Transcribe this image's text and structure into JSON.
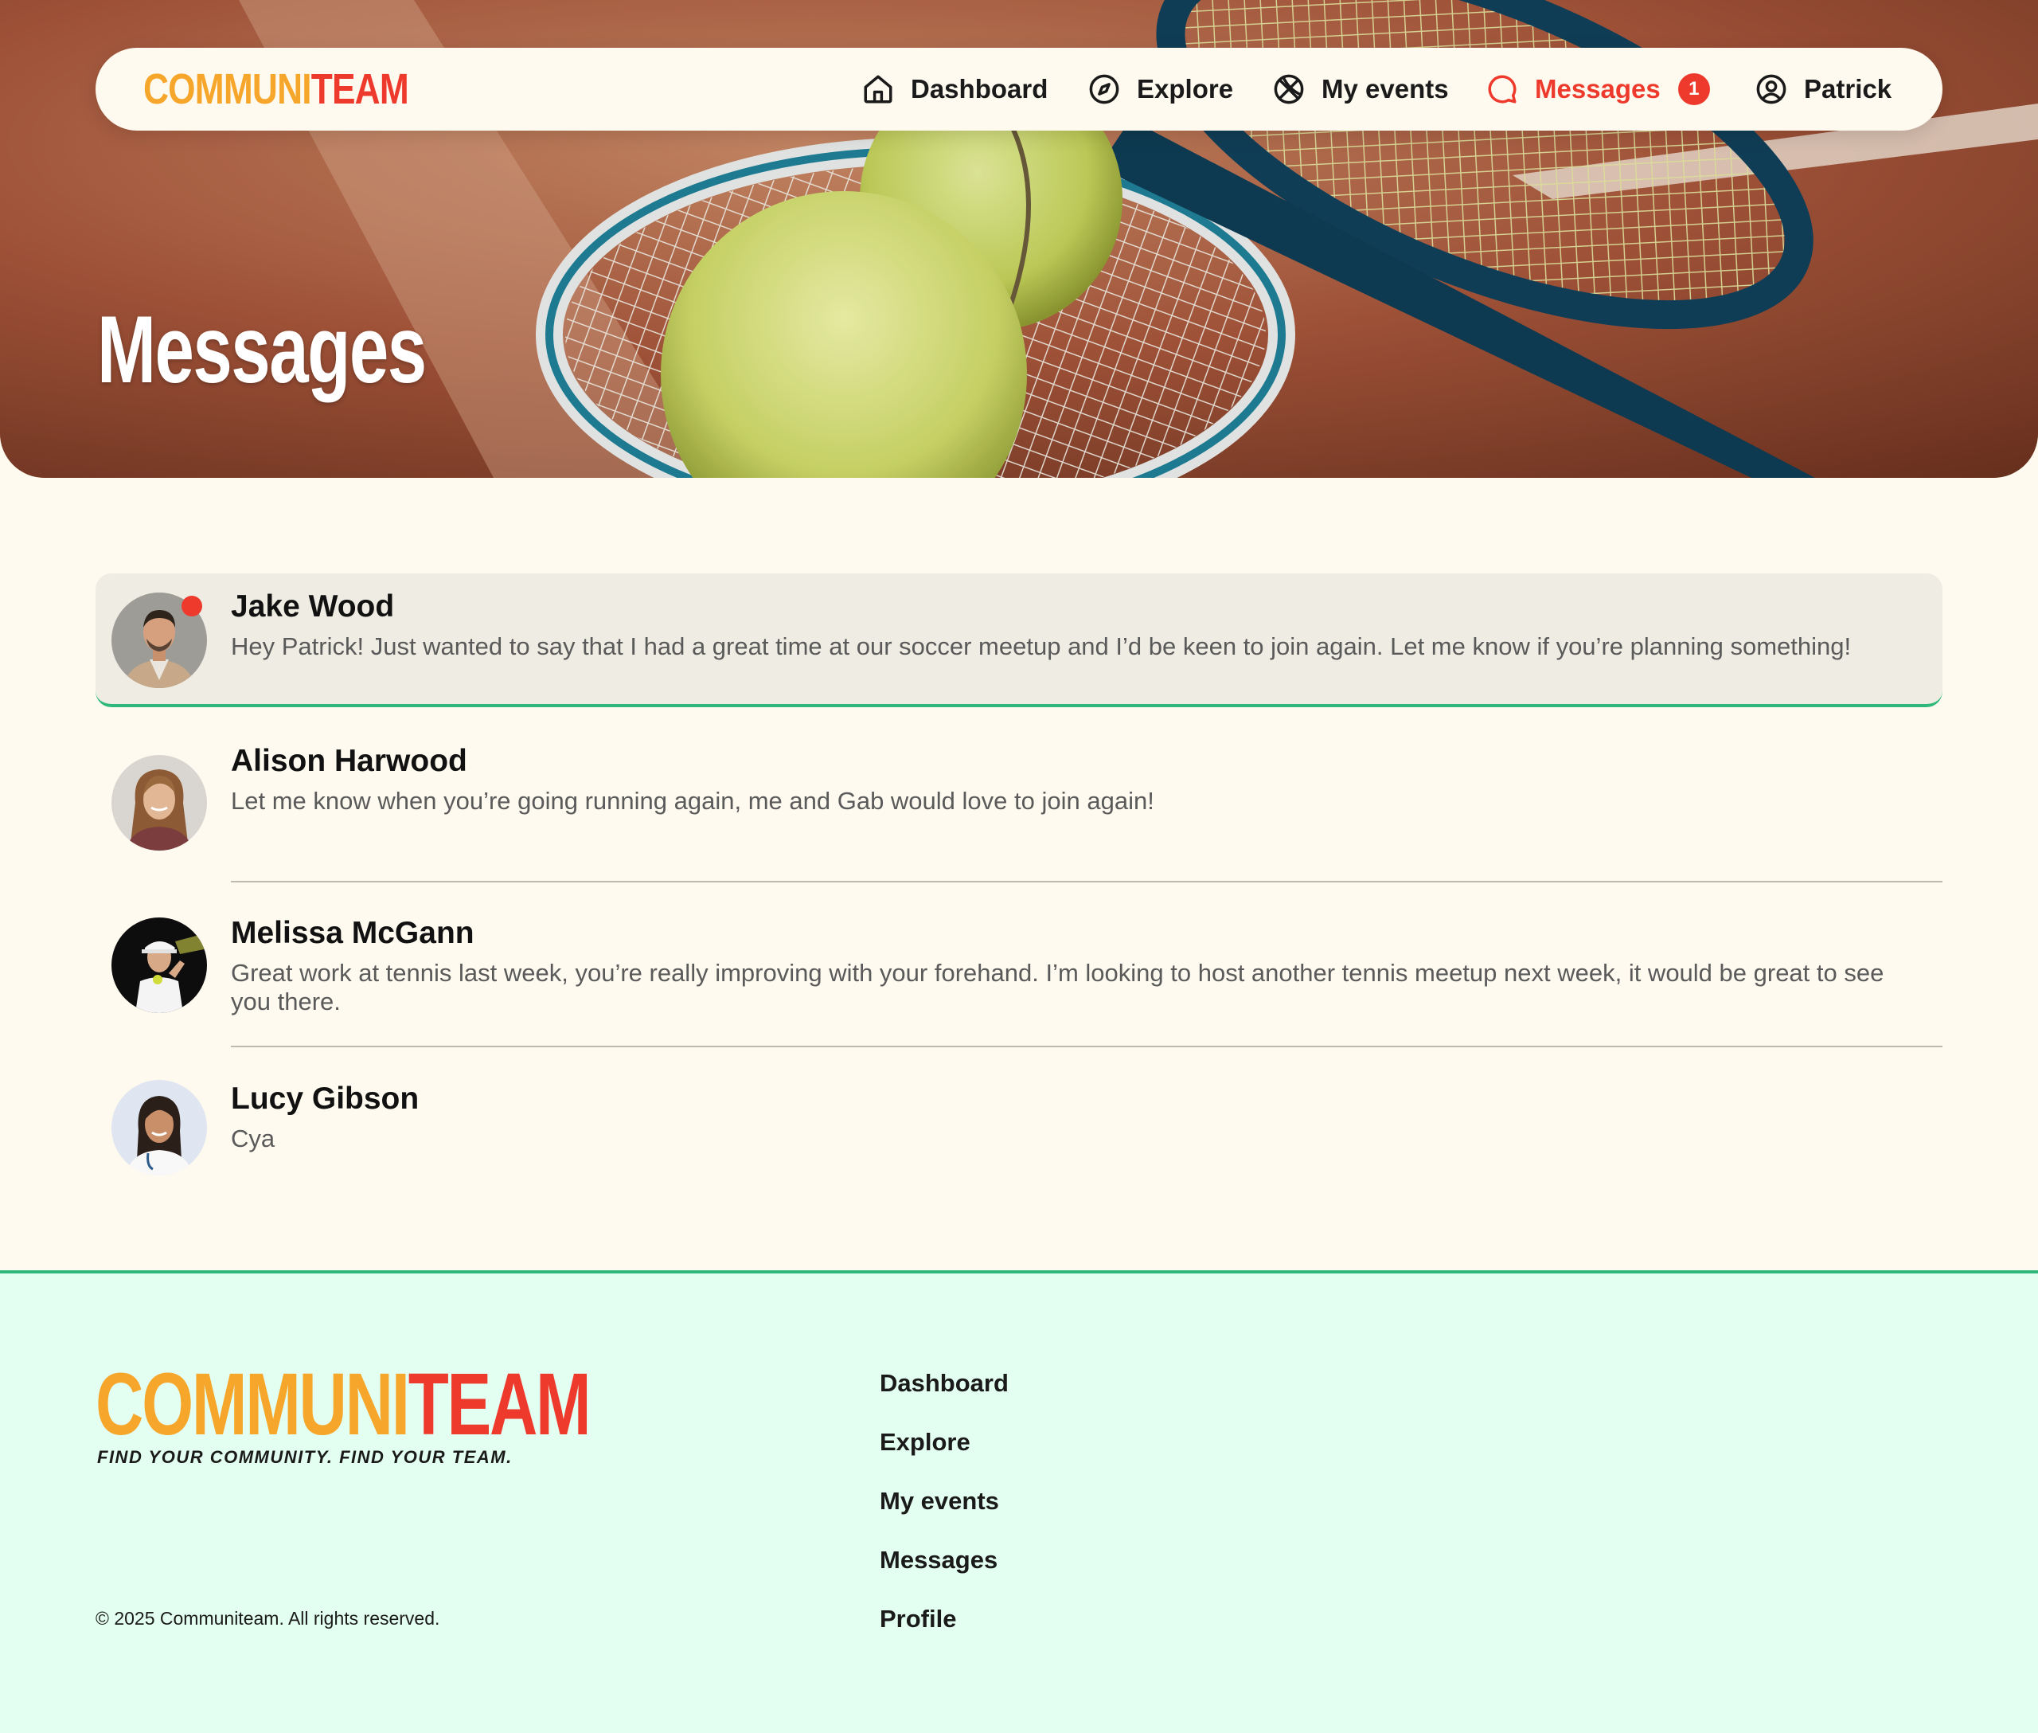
{
  "brand": {
    "logo_part1": "COMMUNI",
    "logo_part2": "TEAM",
    "tagline": "FIND YOUR COMMUNITY. FIND YOUR TEAM.",
    "colors": {
      "orange": "#f6a62a",
      "red": "#ee3a2c",
      "green": "#2fb87a",
      "cream": "#fffaef",
      "mint": "#e3fff2"
    }
  },
  "nav": {
    "items": [
      {
        "label": "Dashboard",
        "icon": "home-icon"
      },
      {
        "label": "Explore",
        "icon": "compass-icon"
      },
      {
        "label": "My events",
        "icon": "ball-icon"
      },
      {
        "label": "Messages",
        "icon": "chat-bubble-icon",
        "active": true,
        "badge": "1"
      },
      {
        "label": "Patrick",
        "icon": "user-circle-icon"
      }
    ]
  },
  "hero": {
    "title": "Messages"
  },
  "messages": [
    {
      "name": "Jake Wood",
      "text": "Hey Patrick! Just wanted to say that I had a great time at our soccer meetup and I’d be keen to join again. Let me know if you’re planning something!",
      "unread": true
    },
    {
      "name": "Alison Harwood",
      "text": "Let me know when you’re going running again, me and Gab would love to join again!",
      "unread": false
    },
    {
      "name": "Melissa McGann",
      "text": "Great work at tennis last week, you’re really improving with your forehand. I’m looking to host another tennis meetup next week, it would be great to see you there.",
      "unread": false
    },
    {
      "name": "Lucy Gibson",
      "text": "Cya",
      "unread": false
    }
  ],
  "footer": {
    "links": [
      "Dashboard",
      "Explore",
      "My events",
      "Messages",
      "Profile"
    ],
    "copyright": "© 2025 Communiteam. All rights reserved."
  }
}
